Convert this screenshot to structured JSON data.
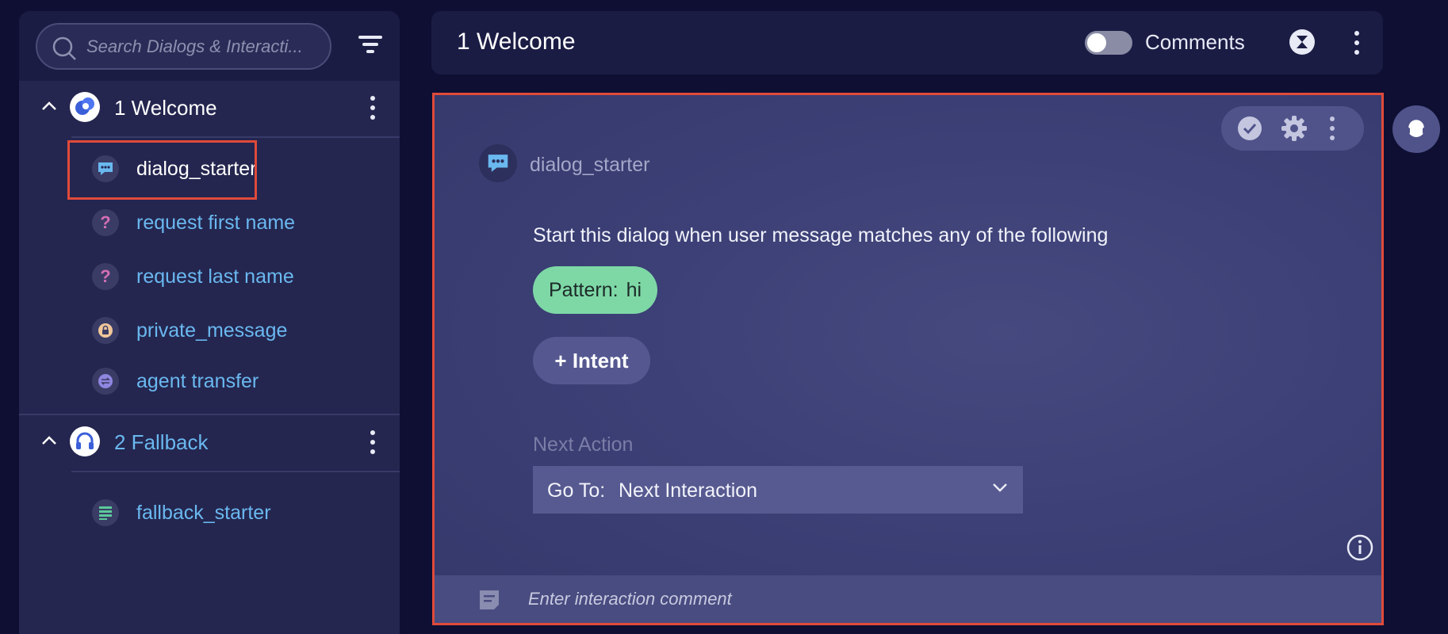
{
  "search": {
    "placeholder": "Search Dialogs & Interacti..."
  },
  "sidebar": {
    "groups": [
      {
        "label": "1 Welcome",
        "items": [
          {
            "label": "dialog_starter",
            "icon": "chat-bubble-icon",
            "selected": true
          },
          {
            "label": "request first name",
            "icon": "question-icon"
          },
          {
            "label": "request last name",
            "icon": "question-icon"
          },
          {
            "label": "private_message",
            "icon": "lock-bubble-icon"
          },
          {
            "label": "agent transfer",
            "icon": "transfer-icon"
          }
        ]
      },
      {
        "label": "2 Fallback",
        "items": [
          {
            "label": "fallback_starter",
            "icon": "list-icon"
          }
        ]
      }
    ],
    "question_glyph": "?"
  },
  "header": {
    "title": "1 Welcome",
    "comments_label": "Comments",
    "comments_enabled": false
  },
  "card": {
    "starter_label": "dialog_starter",
    "start_text": "Start this dialog when user message matches any of the following",
    "pattern": {
      "prefix": "Pattern:",
      "value": "hi"
    },
    "intent_button": "+ Intent",
    "next_action_label": "Next Action",
    "goto": {
      "prefix": "Go To:",
      "value": "Next Interaction"
    },
    "comment_placeholder": "Enter interaction comment"
  },
  "colors": {
    "accent_highlight": "#e04a3a",
    "link_blue": "#6ab8f0",
    "pattern_green": "#7ed8a6",
    "panel_bg": "#24264f"
  }
}
